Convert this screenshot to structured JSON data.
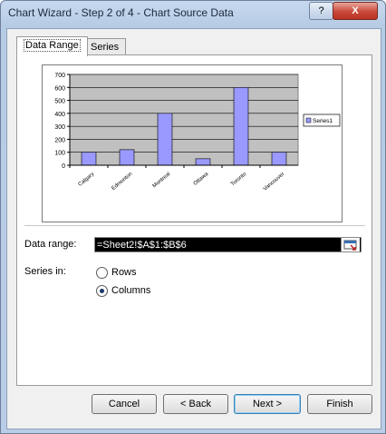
{
  "window": {
    "title": "Chart Wizard - Step 2 of 4 - Chart Source Data",
    "help_label": "?",
    "close_label": "X"
  },
  "tabs": [
    {
      "label": "Data Range",
      "active": true
    },
    {
      "label": "Series",
      "active": false
    }
  ],
  "chart_data": {
    "type": "bar",
    "categories": [
      "Calgary",
      "Edmonton",
      "Montreal",
      "Ottawa",
      "Toronto",
      "Vancouver"
    ],
    "series": [
      {
        "name": "Series1",
        "values": [
          100,
          120,
          400,
          50,
          600,
          100
        ]
      }
    ],
    "ylim": [
      0,
      700
    ],
    "yticks": [
      "0",
      "100",
      "200",
      "300",
      "400",
      "500",
      "600",
      "700"
    ],
    "grid": true,
    "legend": "right",
    "colors": {
      "bar": "#9999ff",
      "plot_bg": "#c0c0c0"
    }
  },
  "form": {
    "data_range_label": "Data range:",
    "data_range_value": "=Sheet2!$A$1:$B$6",
    "series_in_label": "Series in:",
    "rows_label": "Rows",
    "columns_label": "Columns",
    "selected": "Columns"
  },
  "buttons": {
    "cancel": "Cancel",
    "back": "< Back",
    "next": "Next >",
    "finish": "Finish"
  }
}
